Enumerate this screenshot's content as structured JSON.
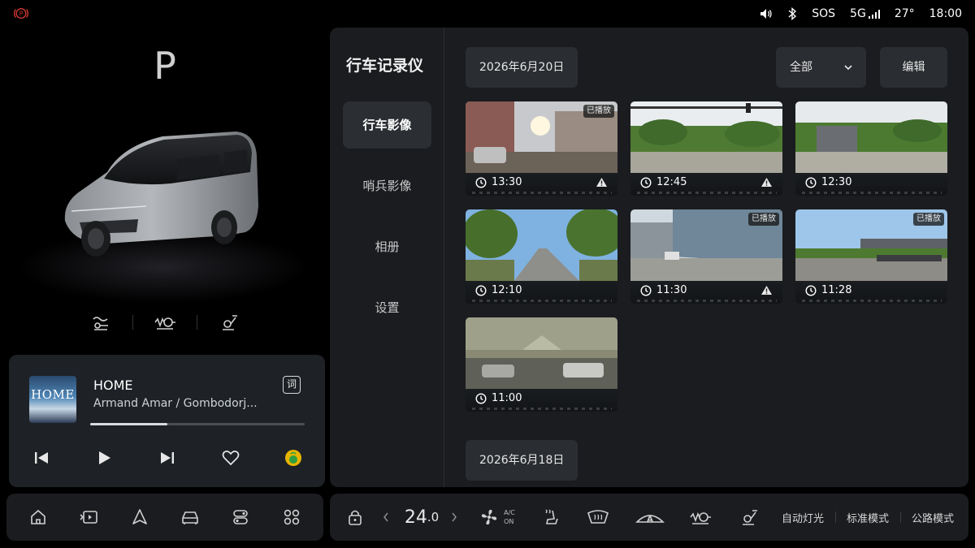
{
  "status_bar": {
    "sos": "SOS",
    "network": "5G",
    "temperature": "27°",
    "time": "18:00",
    "icons": [
      "parking-brake-icon",
      "volume-icon",
      "bluetooth-icon",
      "signal-icon"
    ]
  },
  "vehicle": {
    "gear": "P",
    "mode_icons": [
      "ride-comfort-icon",
      "suspension-icon",
      "steering-icon"
    ]
  },
  "music": {
    "title": "HOME",
    "artist": "Armand Amar / Gombodorj...",
    "album_art_text": "HOME",
    "lyrics_label": "词",
    "progress": 0.36,
    "controls": [
      "previous-track-icon",
      "play-icon",
      "next-track-icon",
      "favorite-icon",
      "music-app-icon"
    ]
  },
  "dock_left": {
    "icons": [
      "home-icon",
      "media-icon",
      "navigation-icon",
      "vehicle-icon",
      "controls-icon",
      "apps-icon"
    ]
  },
  "dashcam": {
    "title": "行车记录仪",
    "nav": [
      {
        "label": "行车影像",
        "active": true
      },
      {
        "label": "哨兵影像",
        "active": false
      },
      {
        "label": "相册",
        "active": false
      },
      {
        "label": "设置",
        "active": false
      }
    ],
    "date_1": "2026年6月20日",
    "date_2": "2026年6月18日",
    "filter": "全部",
    "edit": "编辑",
    "played_label": "已播放",
    "clips": [
      {
        "time": "13:30",
        "played": true,
        "warning": true
      },
      {
        "time": "12:45",
        "played": false,
        "warning": true
      },
      {
        "time": "12:30",
        "played": false,
        "warning": false
      },
      {
        "time": "12:10",
        "played": false,
        "warning": false
      },
      {
        "time": "11:30",
        "played": true,
        "warning": true
      },
      {
        "time": "11:28",
        "played": true,
        "warning": false
      },
      {
        "time": "11:00",
        "played": false,
        "warning": false
      }
    ]
  },
  "dock_right": {
    "temperature": "24",
    "temperature_decimal": ".0",
    "ac_top": "A/C",
    "ac_bottom": "ON",
    "auto_light": "自动灯光",
    "drive_mode": "标准模式",
    "road_mode": "公路模式"
  },
  "colors": {
    "parking_red": "#d23a33",
    "panel_bg": "#1a1c1f",
    "chip_bg": "#2a2d31",
    "music_bg": "#1e2226"
  }
}
